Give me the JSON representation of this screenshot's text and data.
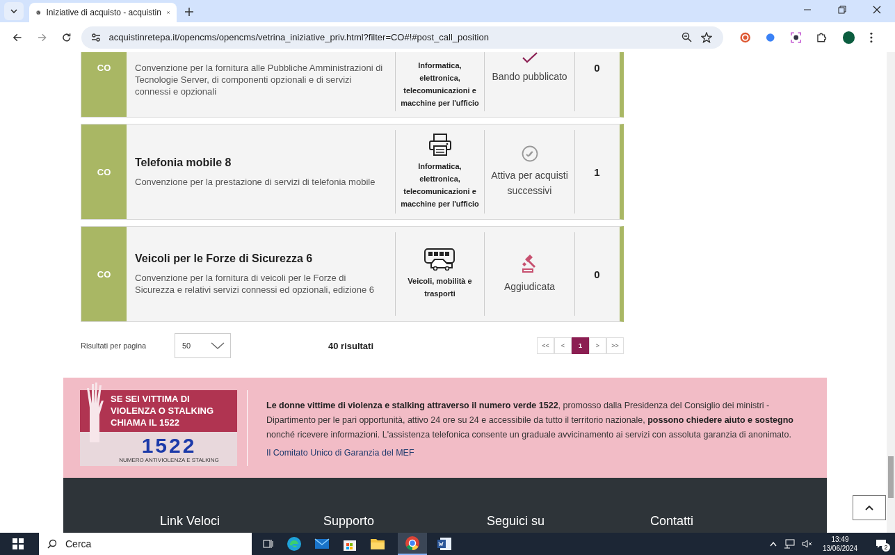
{
  "window": {
    "tab_title": "Iniziative di acquisto - acquistin",
    "url": "acquistinretepa.it/opencms/opencms/vetrina_iniziative_priv.html?filter=CO#!#post_call_position"
  },
  "initiatives": [
    {
      "type": "CO",
      "description": "Convenzione per la fornitura alle Pubbliche Amministrazioni di Tecnologie Server, di componenti opzionali e di servizi connessi e opzionali",
      "category": {
        "kind": "text",
        "label": "Informatica, elettronica, telecomunicazioni e macchine per l'ufficio"
      },
      "status": {
        "kind": "published",
        "label": "Bando pubblicato"
      },
      "count": "0"
    },
    {
      "type": "CO",
      "title": "Telefonia mobile 8",
      "description": "Convenzione per la prestazione di servizi di telefonia mobile",
      "category": {
        "kind": "printer",
        "label": "Informatica, elettronica, telecomunicazioni e macchine per l'ufficio"
      },
      "status": {
        "kind": "active",
        "label": "Attiva per acquisti successivi"
      },
      "count": "1"
    },
    {
      "type": "CO",
      "title": "Veicoli per le Forze di Sicurezza 6",
      "description": "Convenzione per la fornitura di veicoli per le Forze di Sicurezza e relativi servizi connessi ed opzionali, edizione 6",
      "category": {
        "kind": "vehicles",
        "label": "Veicoli, mobilità e trasporti"
      },
      "status": {
        "kind": "awarded",
        "label": "Aggiudicata"
      },
      "count": "0"
    }
  ],
  "results": {
    "per_page_label": "Risultati per pagina",
    "per_page_value": "50",
    "total": "40 risultati",
    "pages": [
      {
        "label": "<<",
        "selected": false
      },
      {
        "label": "<",
        "selected": false
      },
      {
        "label": "1",
        "selected": true
      },
      {
        "label": ">",
        "selected": false
      },
      {
        "label": ">>",
        "selected": false
      }
    ]
  },
  "banner": {
    "image_headline": "SE SEI VITTIMA DI VIOLENZA O STALKING CHIAMA IL 1522",
    "image_number": "1522",
    "image_caption": "NUMERO ANTIVIOLENZA E STALKING",
    "text": "**Le donne vittime di violenza e stalking attraverso il numero verde 1522**, promosso dalla Presidenza del Consiglio dei ministri - Dipartimento per le pari opportunità, attivo 24 ore su 24 e accessibile da tutto il territorio nazionale, **possono chiedere aiuto e sostegno** nonché ricevere informazioni. L'assistenza telefonica consente un graduale avvicinamento ai servizi con assoluta garanzia di anonimato.",
    "link": "Il Comitato Unico di Garanzia del MEF"
  },
  "footer": {
    "headings": [
      "Link Veloci",
      "Supporto",
      "Seguici su",
      "Contatti"
    ]
  },
  "taskbar": {
    "search_placeholder": "Cerca",
    "time": "13:49",
    "date": "13/06/2024",
    "notifications": "2"
  }
}
